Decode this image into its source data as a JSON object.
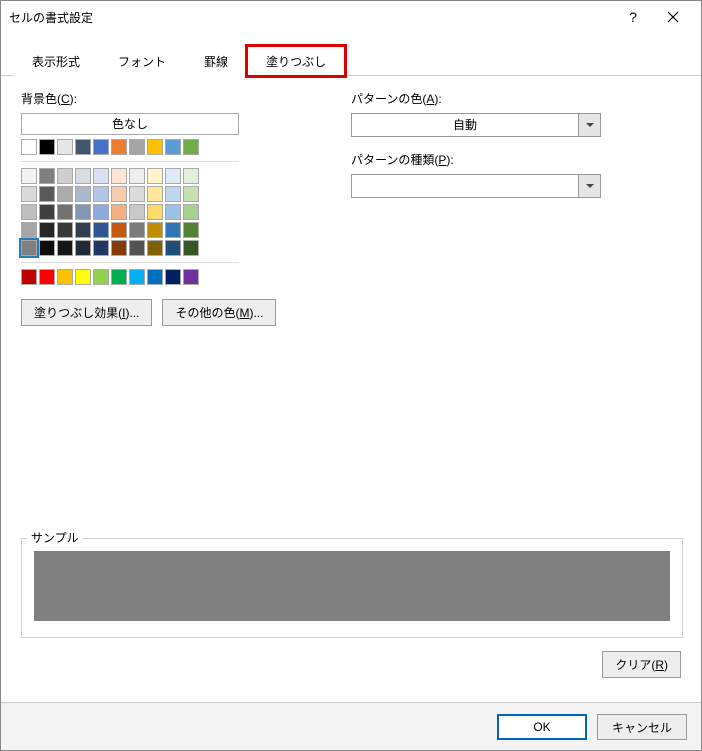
{
  "title": "セルの書式設定",
  "tabs": [
    "表示形式",
    "フォント",
    "罫線",
    "塗りつぶし"
  ],
  "activeTabIndex": 3,
  "bgcolor_label": "背景色(C):",
  "no_color_label": "色なし",
  "theme_row": [
    "#ffffff",
    "#000000",
    "#e7e6e6",
    "#44546a",
    "#4472c4",
    "#ed7d31",
    "#a5a5a5",
    "#ffc000",
    "#5b9bd5",
    "#70ad47"
  ],
  "palette": [
    [
      "#f2f2f2",
      "#7f7f7f",
      "#d0cece",
      "#d6dce4",
      "#d9e1f2",
      "#fce4d6",
      "#ededed",
      "#fff2cc",
      "#ddebf7",
      "#e2efda"
    ],
    [
      "#d9d9d9",
      "#595959",
      "#aeaaaa",
      "#acb9ca",
      "#b4c6e7",
      "#f8cbad",
      "#dbdbdb",
      "#ffe699",
      "#bdd7ee",
      "#c6e0b4"
    ],
    [
      "#bfbfbf",
      "#404040",
      "#757171",
      "#8497b0",
      "#8ea9db",
      "#f4b084",
      "#c9c9c9",
      "#ffd966",
      "#9bc2e6",
      "#a9d08e"
    ],
    [
      "#a6a6a6",
      "#262626",
      "#3a3838",
      "#333f4f",
      "#305496",
      "#c65911",
      "#7b7b7b",
      "#bf8f00",
      "#2f75b5",
      "#548235"
    ],
    [
      "#808080",
      "#0d0d0d",
      "#161616",
      "#222b35",
      "#203764",
      "#833c0c",
      "#525252",
      "#806000",
      "#1f4e78",
      "#375623"
    ]
  ],
  "standard_row": [
    "#c00000",
    "#ff0000",
    "#ffc000",
    "#ffff00",
    "#92d050",
    "#00b050",
    "#00b0f0",
    "#0070c0",
    "#002060",
    "#7030a0"
  ],
  "selected_color": "#808080",
  "fill_effects_label": "塗りつぶし効果(I)...",
  "more_colors_label": "その他の色(M)...",
  "pattern_color_label": "パターンの色(A):",
  "pattern_color_value": "自動",
  "pattern_type_label": "パターンの種類(P):",
  "pattern_type_value": "",
  "sample_label": "サンプル",
  "clear_label": "クリア(R)",
  "ok_label": "OK",
  "cancel_label": "キャンセル"
}
